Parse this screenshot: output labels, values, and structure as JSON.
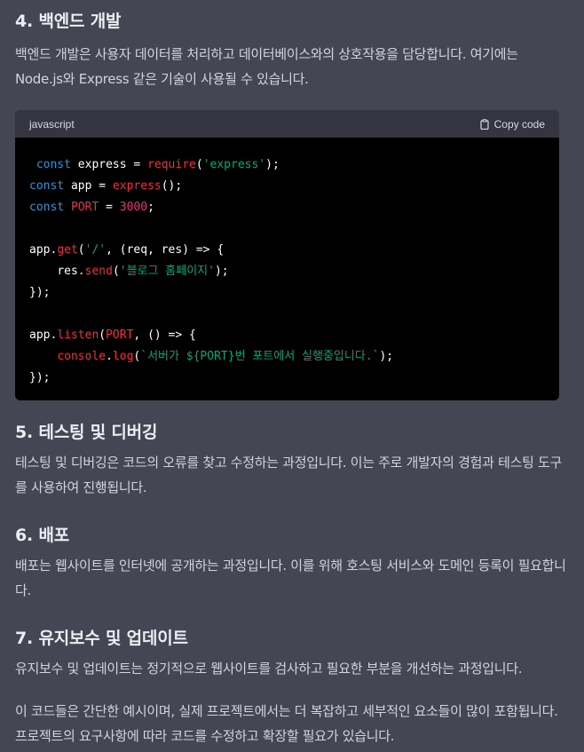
{
  "sections": {
    "backend": {
      "title": "4. 백엔드 개발",
      "text": "백엔드 개발은 사용자 데이터를 처리하고 데이터베이스와의 상호작용을 담당합니다. 여기에는 Node.js와 Express 같은 기술이 사용될 수 있습니다."
    },
    "testing": {
      "title": "5. 테스팅 및 디버깅",
      "text": "테스팅 및 디버깅은 코드의 오류를 찾고 수정하는 과정입니다. 이는 주로 개발자의 경험과 테스팅 도구를 사용하여 진행됩니다."
    },
    "deploy": {
      "title": "6. 배포",
      "text": "배포는 웹사이트를 인터넷에 공개하는 과정입니다. 이를 위해 호스팅 서비스와 도메인 등록이 필요합니다."
    },
    "maintenance": {
      "title": "7. 유지보수 및 업데이트",
      "text": "유지보수 및 업데이트는 정기적으로 웹사이트를 검사하고 필요한 부분을 개선하는 과정입니다."
    },
    "closing": {
      "text": "이 코드들은 간단한 예시이며, 실제 프로젝트에서는 더 복잡하고 세부적인 요소들이 많이 포함됩니다. 프로젝트의 요구사항에 따라 코드를 수정하고 확장할 필요가 있습니다."
    }
  },
  "code_block": {
    "language": "javascript",
    "copy_label": "Copy code",
    "copy_icon": "clipboard-icon",
    "colors": {
      "keyword": "#2e95d3",
      "function": "#f22c3d",
      "string": "#00a67d",
      "number": "#df3079"
    },
    "tokens": {
      "const": "const",
      "express_var": "express",
      "require_fn": "require",
      "express_str": "'express'",
      "app_var": "app",
      "express_call": "express",
      "port_var": "PORT",
      "port_num": "3000",
      "app_get_obj": "app",
      "get_fn": "get",
      "root_str": "'/'",
      "params_get": "(req, res) => {",
      "res_obj": "res",
      "send_fn": "send",
      "home_str": "'블로그 홈페이지'",
      "close_get": "});",
      "app_listen_obj": "app",
      "listen_fn": "listen",
      "port_ref": "PORT",
      "params_listen": ", () => {",
      "console_obj": "console",
      "log_fn": "log",
      "template_str": "`서버가 ${PORT}번 포트에서 실행중입니다.`",
      "close_listen": "});"
    }
  }
}
